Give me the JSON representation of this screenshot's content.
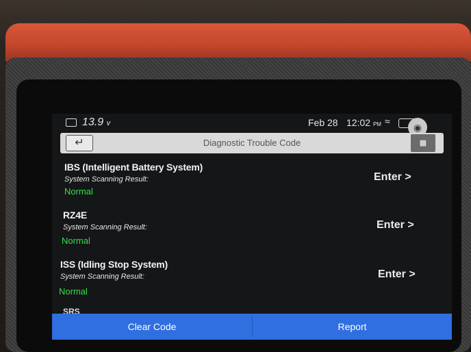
{
  "statusbar": {
    "voltage": "13.9",
    "voltage_unit": "v",
    "date": "Feb 28",
    "time": "12:02",
    "time_suffix": "PM"
  },
  "header": {
    "title": "Diagnostic Trouble Code",
    "back_icon": "back-arrow-icon",
    "right_icon": "report-icon"
  },
  "systems": [
    {
      "name": "IBS (Intelligent Battery System)",
      "scan_label": "System Scanning Result:",
      "status": "Normal",
      "enter_label": "Enter >"
    },
    {
      "name": "RZ4E",
      "scan_label": "System Scanning Result:",
      "status": "Normal",
      "enter_label": "Enter >"
    },
    {
      "name": "ISS (Idling Stop System)",
      "scan_label": "System Scanning Result:",
      "status": "Normal",
      "enter_label": "Enter >"
    }
  ],
  "partial_item": "SRS",
  "footer": {
    "clear_code_label": "Clear Code",
    "report_label": "Report"
  },
  "colors": {
    "accent_blue": "#2f6fe0",
    "status_green": "#35e04a",
    "device_orange": "#c4472d"
  }
}
